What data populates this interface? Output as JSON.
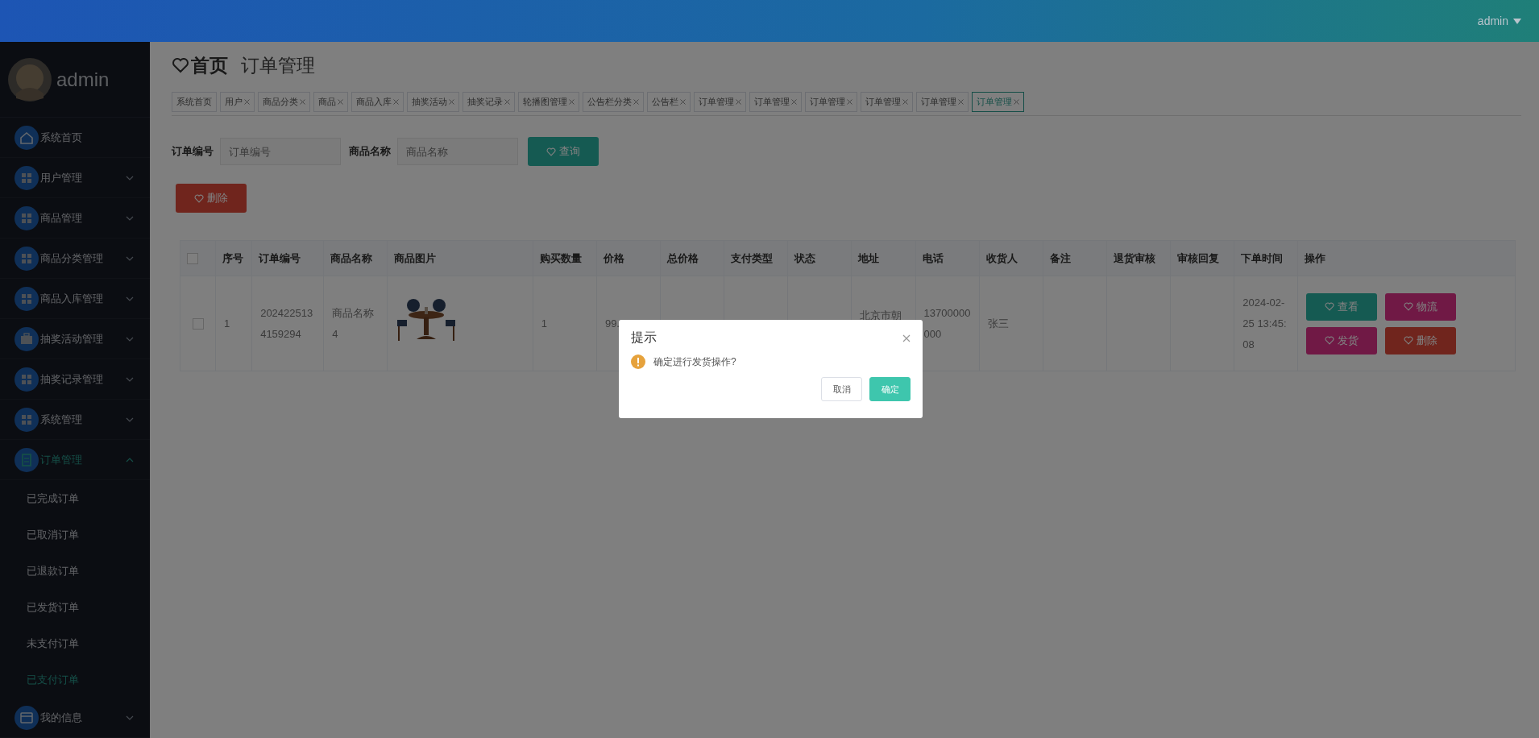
{
  "topbar": {
    "user": "admin"
  },
  "sidebar": {
    "user": "admin",
    "items": [
      {
        "label": "系统首页",
        "kind": "home",
        "expandable": false,
        "selected": false
      },
      {
        "label": "用户管理",
        "kind": "grid",
        "expandable": true,
        "expanded": false,
        "selected": false
      },
      {
        "label": "商品管理",
        "kind": "grid",
        "expandable": true,
        "expanded": false,
        "selected": false
      },
      {
        "label": "商品分类管理",
        "kind": "grid",
        "expandable": true,
        "expanded": false,
        "selected": false
      },
      {
        "label": "商品入库管理",
        "kind": "grid",
        "expandable": true,
        "expanded": false,
        "selected": false
      },
      {
        "label": "抽奖活动管理",
        "kind": "briefcase",
        "expandable": true,
        "expanded": false,
        "selected": false
      },
      {
        "label": "抽奖记录管理",
        "kind": "grid",
        "expandable": true,
        "expanded": false,
        "selected": false
      },
      {
        "label": "系统管理",
        "kind": "grid",
        "expandable": true,
        "expanded": false,
        "selected": false
      },
      {
        "label": "订单管理",
        "kind": "clipboard",
        "expandable": true,
        "expanded": true,
        "selected": true,
        "children": [
          {
            "label": "已完成订单",
            "selected": false
          },
          {
            "label": "已取消订单",
            "selected": false
          },
          {
            "label": "已退款订单",
            "selected": false
          },
          {
            "label": "已发货订单",
            "selected": false
          },
          {
            "label": "未支付订单",
            "selected": false
          },
          {
            "label": "已支付订单",
            "selected": true
          }
        ]
      },
      {
        "label": "我的信息",
        "kind": "card",
        "expandable": true,
        "expanded": false,
        "selected": false
      }
    ]
  },
  "breadcrumb": {
    "home": "首页",
    "current": "订单管理"
  },
  "tabs": [
    {
      "label": "系统首页",
      "closable": false,
      "selected": false
    },
    {
      "label": "用户",
      "closable": true,
      "selected": false
    },
    {
      "label": "商品分类",
      "closable": true,
      "selected": false
    },
    {
      "label": "商品",
      "closable": true,
      "selected": false
    },
    {
      "label": "商品入库",
      "closable": true,
      "selected": false
    },
    {
      "label": "抽奖活动",
      "closable": true,
      "selected": false
    },
    {
      "label": "抽奖记录",
      "closable": true,
      "selected": false
    },
    {
      "label": "轮播图管理",
      "closable": true,
      "selected": false
    },
    {
      "label": "公告栏分类",
      "closable": true,
      "selected": false
    },
    {
      "label": "公告栏",
      "closable": true,
      "selected": false
    },
    {
      "label": "订单管理",
      "closable": true,
      "selected": false
    },
    {
      "label": "订单管理",
      "closable": true,
      "selected": false
    },
    {
      "label": "订单管理",
      "closable": true,
      "selected": false
    },
    {
      "label": "订单管理",
      "closable": true,
      "selected": false
    },
    {
      "label": "订单管理",
      "closable": true,
      "selected": false
    },
    {
      "label": "订单管理",
      "closable": true,
      "selected": true
    }
  ],
  "filters": [
    {
      "label": "订单编号",
      "placeholder": "订单编号"
    },
    {
      "label": "商品名称",
      "placeholder": "商品名称"
    }
  ],
  "query_button": "查询",
  "delete_button": "删除",
  "table": {
    "columns": [
      "序号",
      "订单编号",
      "商品名称",
      "商品图片",
      "购买数量",
      "价格",
      "总价格",
      "支付类型",
      "状态",
      "地址",
      "电话",
      "收货人",
      "备注",
      "退货审核",
      "审核回复",
      "下单时间",
      "操作"
    ],
    "all_checked": false,
    "rows": [
      {
        "checked": false,
        "cells": [
          {
            "kind": "text",
            "text": "1"
          },
          {
            "kind": "text",
            "text": "2024225134159294"
          },
          {
            "kind": "text",
            "text": "商品名称4"
          },
          {
            "kind": "picture"
          },
          {
            "kind": "text",
            "text": "1"
          },
          {
            "kind": "text",
            "text": "99."
          },
          {
            "kind": "blank"
          },
          {
            "kind": "blank"
          },
          {
            "kind": "blank"
          },
          {
            "kind": "top",
            "text": "北京市朝"
          },
          {
            "kind": "text",
            "text": "13700000000"
          },
          {
            "kind": "text",
            "text": "张三"
          },
          {
            "kind": "blank"
          },
          {
            "kind": "blank"
          },
          {
            "kind": "blank"
          },
          {
            "kind": "text",
            "text": "2024-02-25 13:45:08"
          },
          {
            "kind": "actions",
            "actions": [
              {
                "label": "查看",
                "kind": "view"
              },
              {
                "label": "物流",
                "kind": "logistics"
              },
              {
                "label": "发货",
                "kind": "ship"
              },
              {
                "label": "删除",
                "kind": "delete"
              }
            ]
          }
        ]
      }
    ]
  },
  "dialog": {
    "title": "提示",
    "message": "确定进行发货操作?",
    "buttons": [
      {
        "label": "取消",
        "kind": "default"
      },
      {
        "label": "确定",
        "kind": "primary"
      }
    ]
  }
}
